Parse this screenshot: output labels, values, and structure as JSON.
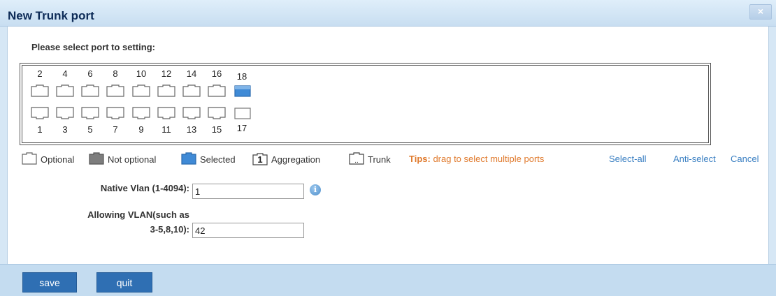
{
  "dialog": {
    "title": "New Trunk port",
    "close_label": "×"
  },
  "instruction": "Please select port to setting:",
  "ports": {
    "top_row": [
      {
        "num": "2",
        "state": "optional"
      },
      {
        "num": "4",
        "state": "optional"
      },
      {
        "num": "6",
        "state": "optional"
      },
      {
        "num": "8",
        "state": "optional"
      },
      {
        "num": "10",
        "state": "optional"
      },
      {
        "num": "12",
        "state": "optional"
      },
      {
        "num": "14",
        "state": "optional"
      },
      {
        "num": "16",
        "state": "optional"
      },
      {
        "num": "18",
        "state": "selected"
      }
    ],
    "bottom_row": [
      {
        "num": "1",
        "state": "optional"
      },
      {
        "num": "3",
        "state": "optional"
      },
      {
        "num": "5",
        "state": "optional"
      },
      {
        "num": "7",
        "state": "optional"
      },
      {
        "num": "9",
        "state": "optional"
      },
      {
        "num": "11",
        "state": "optional"
      },
      {
        "num": "13",
        "state": "optional"
      },
      {
        "num": "15",
        "state": "optional"
      },
      {
        "num": "17",
        "state": "optional-fiber"
      }
    ]
  },
  "legend": {
    "optional": "Optional",
    "not_optional": "Not optional",
    "selected": "Selected",
    "aggregation": "Aggregation",
    "aggregation_badge": "1",
    "trunk": "Trunk",
    "tips_label": "Tips:",
    "tips_text": " drag to select multiple ports"
  },
  "actions": {
    "select_all": "Select-all",
    "anti_select": "Anti-select",
    "cancel": "Cancel"
  },
  "form": {
    "native_vlan_label": "Native Vlan (1-4094):",
    "native_vlan_value": "1",
    "allowing_vlan_label_line1": "Allowing VLAN(such as",
    "allowing_vlan_label_line2": "3-5,8,10):",
    "allowing_vlan_value": "42",
    "info_glyph": "i"
  },
  "footer": {
    "save_label": "save",
    "quit_label": "quit"
  },
  "colors": {
    "selected_port": "#3f8ad6",
    "not_optional_port": "#7d7d7d",
    "tips": "#e07a2d",
    "link": "#3a7fc2",
    "button": "#2f6fb3"
  }
}
